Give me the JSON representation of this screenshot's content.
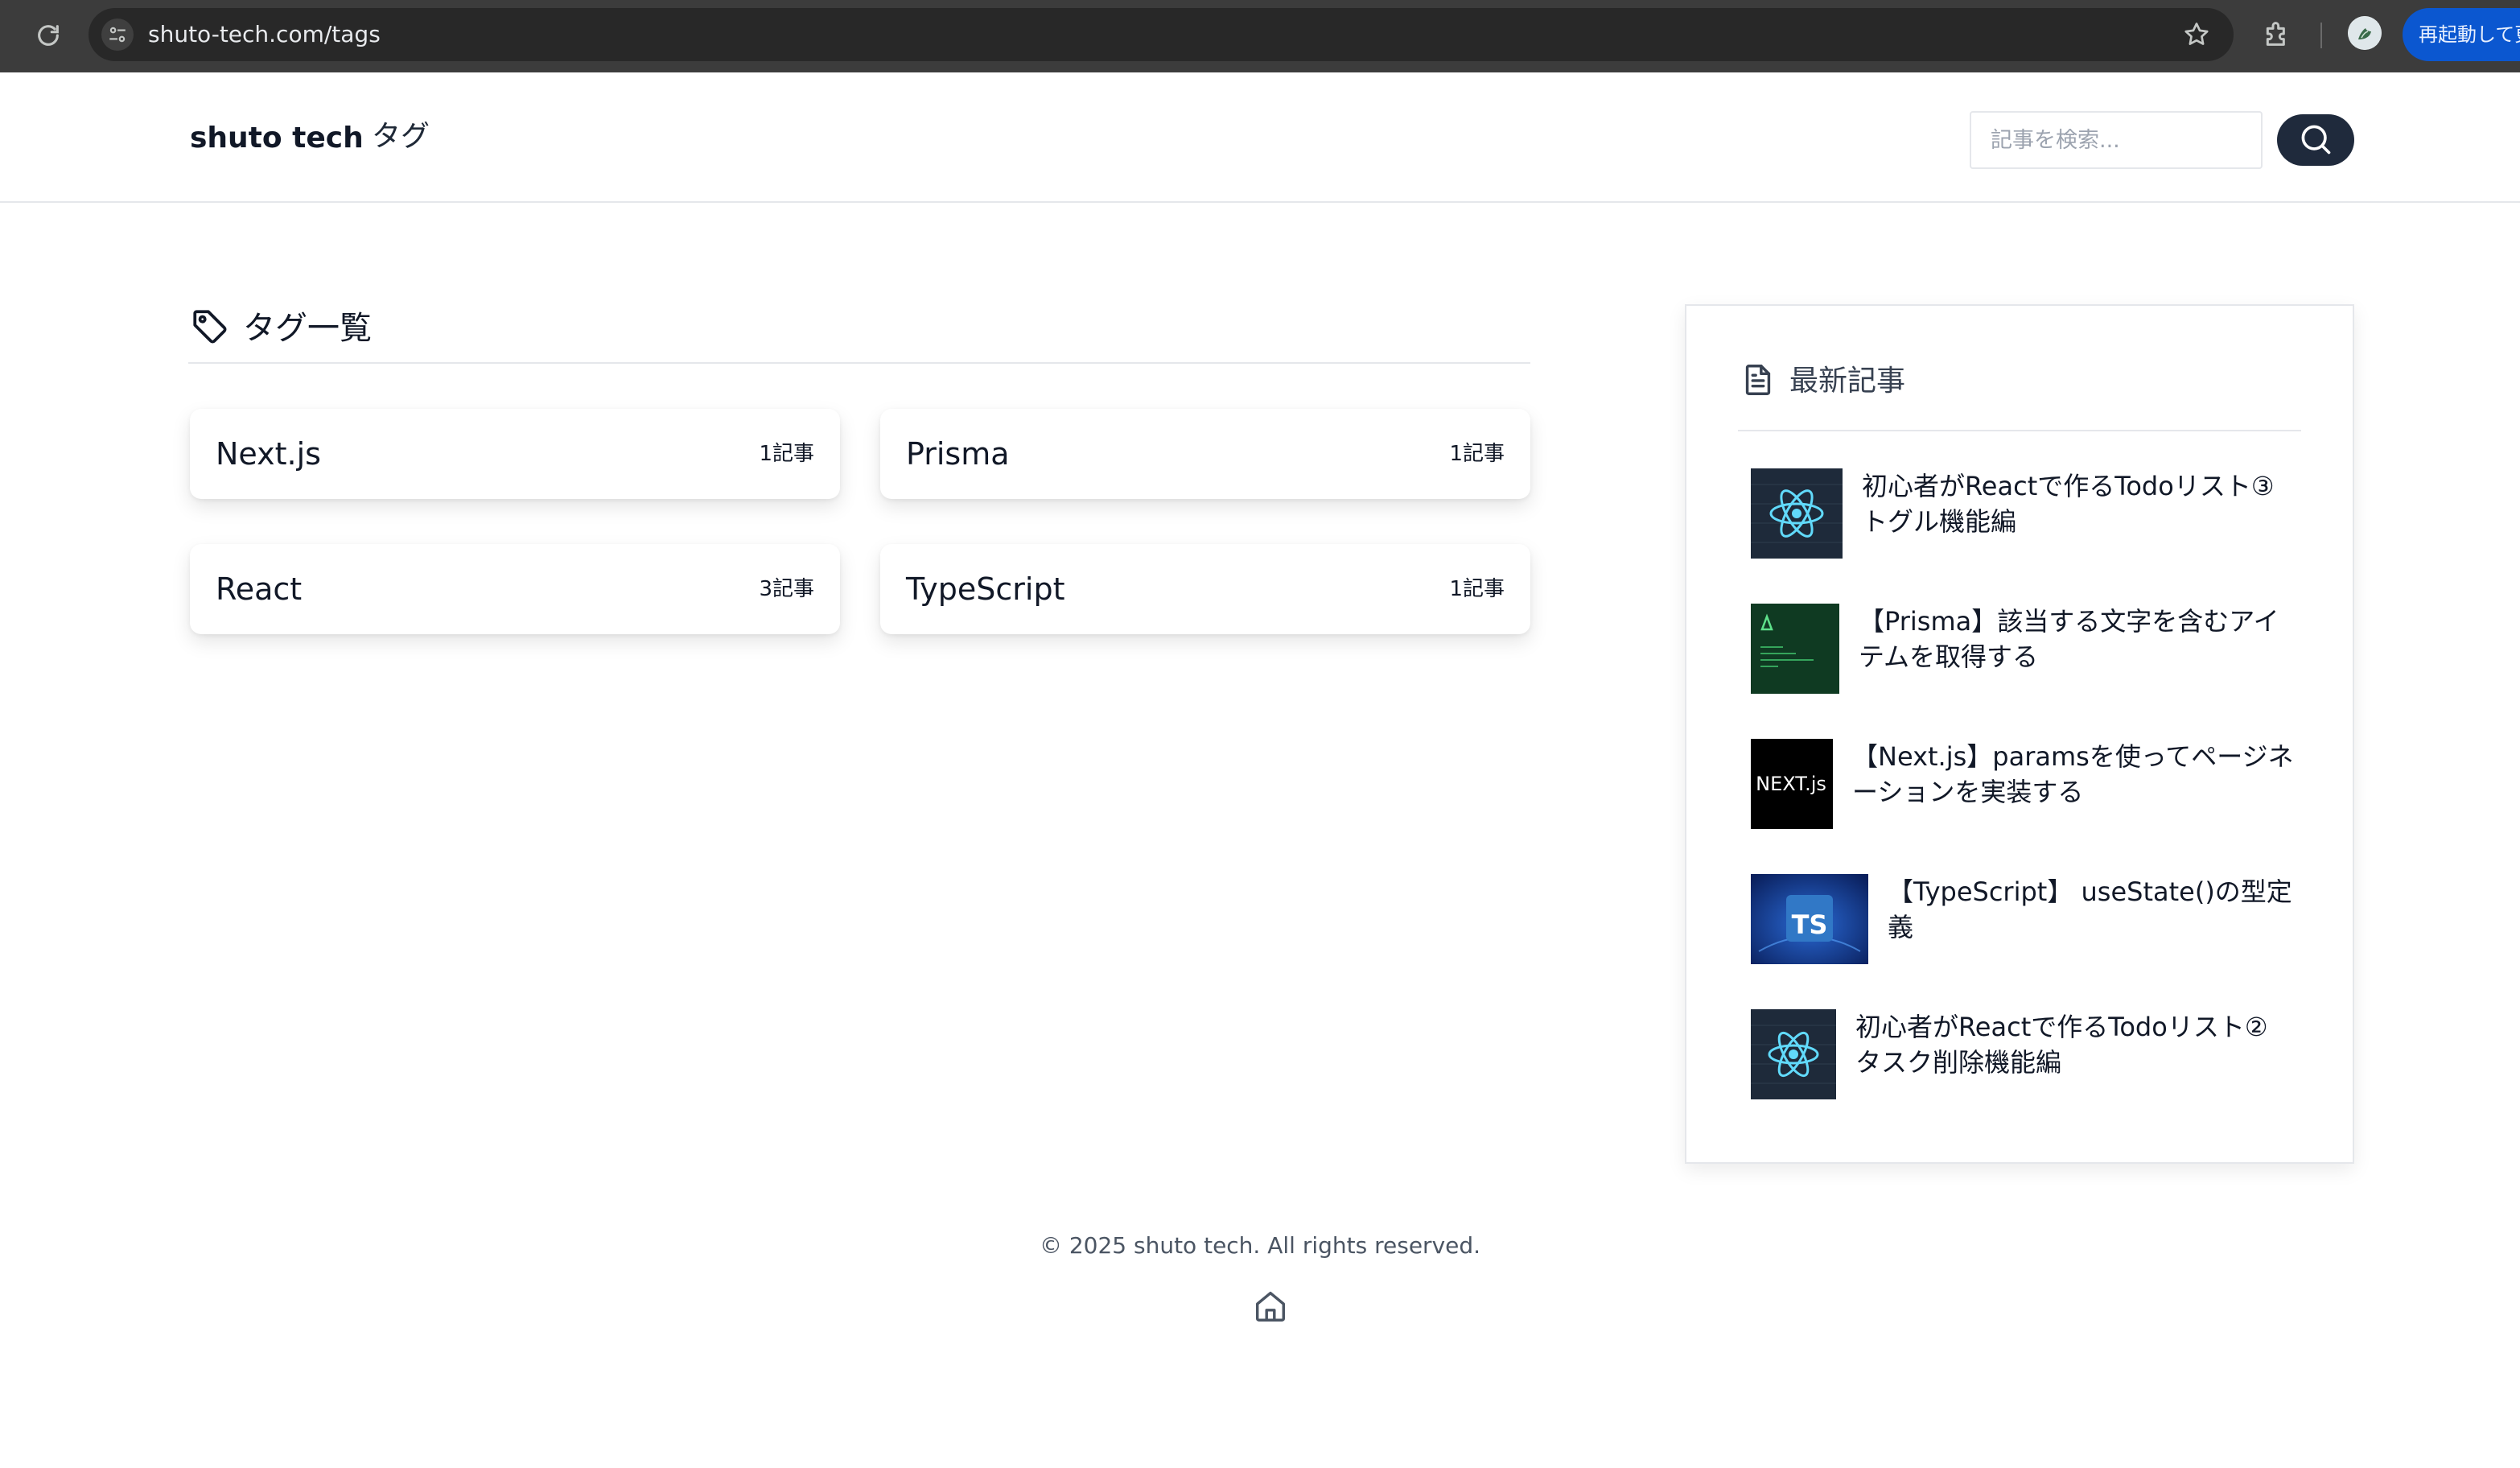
{
  "browser": {
    "url": "shuto-tech.com/tags",
    "restart_label": "再起動して更新"
  },
  "header": {
    "brand": "shuto tech",
    "nav_tags": "タグ",
    "search_placeholder": "記事を検索..."
  },
  "tags_section": {
    "title": "タグ一覧",
    "tags": [
      {
        "name": "Next.js",
        "count": "1記事"
      },
      {
        "name": "Prisma",
        "count": "1記事"
      },
      {
        "name": "React",
        "count": "3記事"
      },
      {
        "name": "TypeScript",
        "count": "1記事"
      }
    ]
  },
  "sidebar": {
    "title": "最新記事",
    "posts": [
      {
        "title": "初心者がReactで作るTodoリスト③ トグル機能編",
        "thumb": "react-logo"
      },
      {
        "title": "【Prisma】該当する文字を含むアイテムを取得する",
        "thumb": "prisma-code"
      },
      {
        "title": "【Next.js】paramsを使ってページネーションを実装する",
        "thumb": "nextjs-logo",
        "thumb_text": "NEXT.js"
      },
      {
        "title": "【TypeScript】 useState()の型定義",
        "thumb": "typescript-logo",
        "thumb_text": "TS"
      },
      {
        "title": "初心者がReactで作るTodoリスト② タスク削除機能編",
        "thumb": "react-logo"
      }
    ]
  },
  "footer": {
    "copyright": "© 2025 shuto tech. All rights reserved."
  },
  "colors": {
    "chrome_bg": "#3c3c3c",
    "omnibox_bg": "#282828",
    "search_button": "#1f2a3c",
    "restart_button": "#0b57d0",
    "react_cyan": "#61dafb"
  }
}
